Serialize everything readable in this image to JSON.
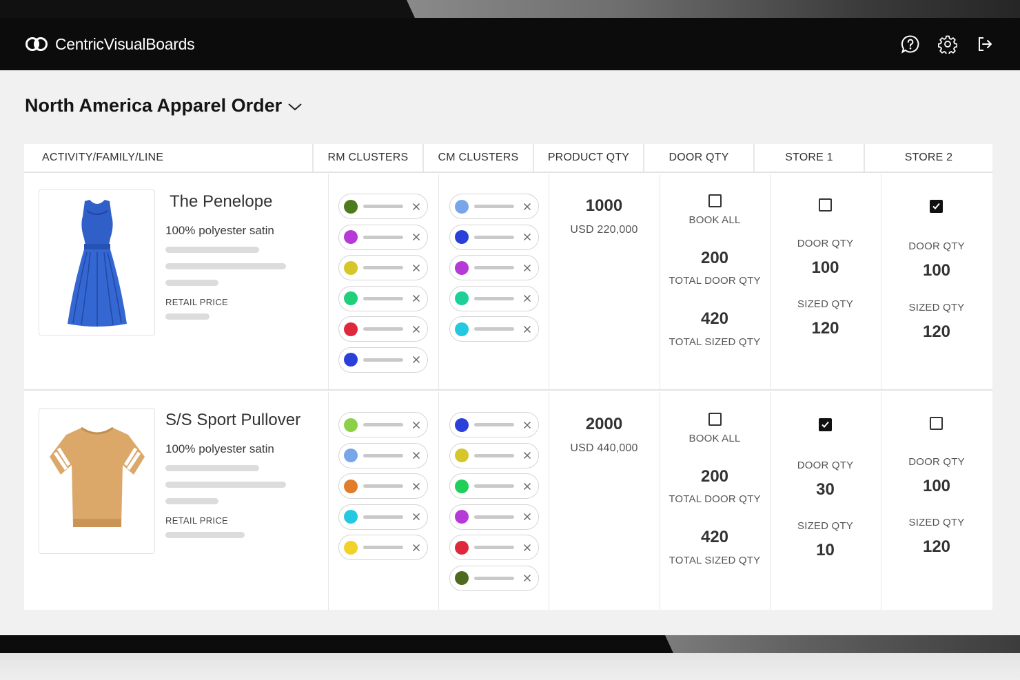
{
  "app": {
    "brand_primary": "Centric",
    "brand_secondary": "VisualBoards"
  },
  "header": {
    "icons": [
      "help-icon",
      "settings-icon",
      "logout-icon"
    ]
  },
  "page": {
    "title": "North America Apparel Order"
  },
  "table": {
    "columns": [
      "ACTIVITY/FAMILY/LINE",
      "RM CLUSTERS",
      "CM CLUSTERS",
      "PRODUCT QTY",
      "DOOR QTY",
      "STORE 1",
      "STORE 2"
    ],
    "rows": [
      {
        "name": "The Penelope",
        "material": "100% polyester satin",
        "retail_label": "RETAIL PRICE",
        "rm_clusters": [
          "#4e7a1f",
          "#b53ad8",
          "#d6c62a",
          "#1fcf7a",
          "#e0283c",
          "#2b40d8"
        ],
        "cm_clusters": [
          "#79a6e8",
          "#2b40d8",
          "#b53ad8",
          "#1fcf9a",
          "#24c8e0"
        ],
        "product_qty": "1000",
        "product_value": "USD 220,000",
        "door": {
          "book_all_label": "BOOK ALL",
          "book_all_checked": false,
          "total_door_qty": "200",
          "total_door_label": "TOTAL DOOR QTY",
          "total_sized_qty": "420",
          "total_sized_label": "TOTAL SIZED QTY"
        },
        "store1": {
          "checked": false,
          "door_label": "DOOR QTY",
          "door_qty": "100",
          "sized_label": "SIZED QTY",
          "sized_qty": "120"
        },
        "store2": {
          "checked": true,
          "door_label": "DOOR QTY",
          "door_qty": "100",
          "sized_label": "SIZED QTY",
          "sized_qty": "120"
        }
      },
      {
        "name": "S/S Sport Pullover",
        "material": "100% polyester satin",
        "retail_label": "RETAIL PRICE",
        "rm_clusters": [
          "#8cd04a",
          "#79a6e8",
          "#e07c2a",
          "#24c8e0",
          "#f0d22a"
        ],
        "cm_clusters": [
          "#2b40d8",
          "#d6c62a",
          "#1fcf5a",
          "#b53ad8",
          "#e0283c",
          "#4e6a1f"
        ],
        "product_qty": "2000",
        "product_value": "USD 440,000",
        "door": {
          "book_all_label": "BOOK ALL",
          "book_all_checked": false,
          "total_door_qty": "200",
          "total_door_label": "TOTAL DOOR QTY",
          "total_sized_qty": "420",
          "total_sized_label": "TOTAL SIZED QTY"
        },
        "store1": {
          "checked": true,
          "door_label": "DOOR QTY",
          "door_qty": "30",
          "sized_label": "SIZED QTY",
          "sized_qty": "10"
        },
        "store2": {
          "checked": false,
          "door_label": "DOOR QTY",
          "door_qty": "100",
          "sized_label": "SIZED QTY",
          "sized_qty": "120"
        }
      }
    ]
  }
}
